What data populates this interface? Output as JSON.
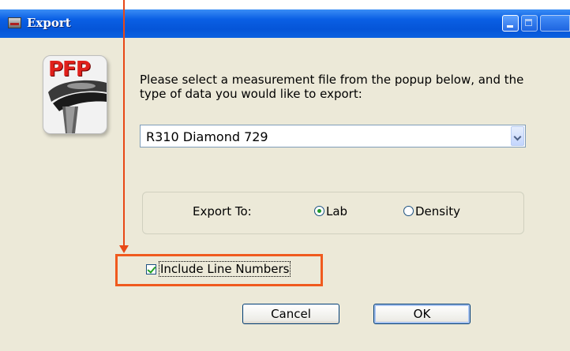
{
  "window": {
    "title": "Export",
    "icon": "printer-icon",
    "buttons": [
      "minimize-icon",
      "maximize-icon",
      "close-icon"
    ]
  },
  "app_icon": {
    "text": "PFP",
    "icon": "pfp-app-logo"
  },
  "instruction": "Please select a measurement file from the popup below, and the type of data you would like to export:",
  "file_select": {
    "selected": "R310 Diamond 729",
    "icon": "chevron-down-icon"
  },
  "export_to": {
    "label": "Export To:",
    "options": [
      {
        "label": "Lab",
        "checked": true
      },
      {
        "label": "Density",
        "checked": false
      }
    ]
  },
  "include_line_numbers": {
    "label": "Include Line Numbers",
    "checked": true
  },
  "buttons": {
    "cancel": "Cancel",
    "ok": "OK"
  },
  "annotation": {
    "color": "#f05a1e"
  }
}
